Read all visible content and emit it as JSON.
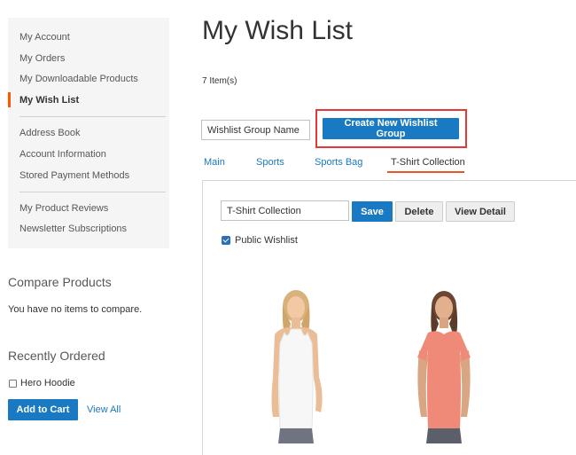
{
  "sidebar": {
    "nav": {
      "items": [
        {
          "label": "My Account"
        },
        {
          "label": "My Orders"
        },
        {
          "label": "My Downloadable Products"
        },
        {
          "label": "My Wish List"
        },
        {
          "label": "Address Book"
        },
        {
          "label": "Account Information"
        },
        {
          "label": "Stored Payment Methods"
        },
        {
          "label": "My Product Reviews"
        },
        {
          "label": "Newsletter Subscriptions"
        }
      ],
      "current": "My Wish List"
    },
    "compare": {
      "title": "Compare Products",
      "empty_text": "You have no items to compare."
    },
    "recently_ordered": {
      "title": "Recently Ordered",
      "item_label": "Hero Hoodie",
      "add_to_cart_label": "Add to Cart",
      "view_all_label": "View All"
    }
  },
  "main": {
    "title": "My Wish List",
    "item_count": "7 Item(s)",
    "group_name_placeholder": "Wishlist Group Name",
    "create_group_label": "Create New Wishlist Group",
    "tabs": [
      {
        "label": "Main"
      },
      {
        "label": "Sports"
      },
      {
        "label": "Sports Bag"
      },
      {
        "label": "T-Shirt Collection"
      }
    ],
    "active_tab": "T-Shirt Collection",
    "panel": {
      "group_name_value": "T-Shirt Collection",
      "save_label": "Save",
      "delete_label": "Delete",
      "view_detail_label": "View Detail",
      "public_label": "Public Wishlist",
      "public_checked": true
    }
  },
  "colors": {
    "primary": "#1979c3",
    "highlight_border": "#e53935",
    "active_tab_underline": "#e8542a",
    "nav_current_marker": "#ff5501"
  }
}
